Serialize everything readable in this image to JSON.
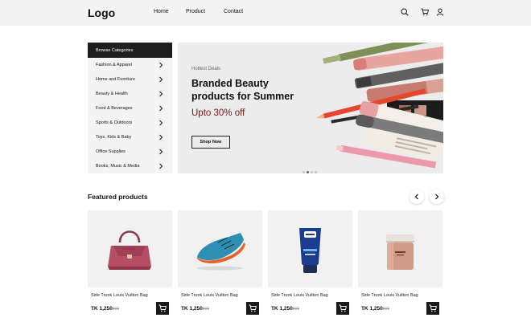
{
  "header": {
    "logo": "Logo",
    "nav": [
      "Home",
      "Product",
      "Contact"
    ],
    "icons": [
      "search-icon",
      "cart-icon",
      "user-icon"
    ]
  },
  "sidebar": {
    "title": "Browse Categories",
    "items": [
      "Fashion & Apparel",
      "Home and Furniture",
      "Beauty & Health",
      "Food & Beverages",
      "Sports & Outdoors",
      "Toys, Kids & Baby",
      "Office Supplies",
      "Books, Music & Media"
    ]
  },
  "hero": {
    "kicker": "Hottest Deals",
    "title": "Branded Beauty products for Summer",
    "offer": "Upto 30% off",
    "button": "Shop Now",
    "slide_count": 4,
    "active_slide": 1,
    "offer_color": "#7a1212"
  },
  "featured": {
    "title": "Featured products",
    "products": [
      {
        "name": "Side Trunk Louis Vuitton Bag",
        "price": "TK 1,250",
        "old_price": "1500",
        "image": "handbag-image"
      },
      {
        "name": "Side Trunk Louis Vuitton Bag",
        "price": "TK 1,250",
        "old_price": "1500",
        "image": "sneaker-image"
      },
      {
        "name": "Side Trunk Louis Vuitton Bag",
        "price": "TK 1,250",
        "old_price": "1500",
        "image": "face-wash-tube-image"
      },
      {
        "name": "Side Trunk Louis Vuitton Bag",
        "price": "TK 1,250",
        "old_price": "1500",
        "image": "cream-jar-image"
      }
    ]
  }
}
